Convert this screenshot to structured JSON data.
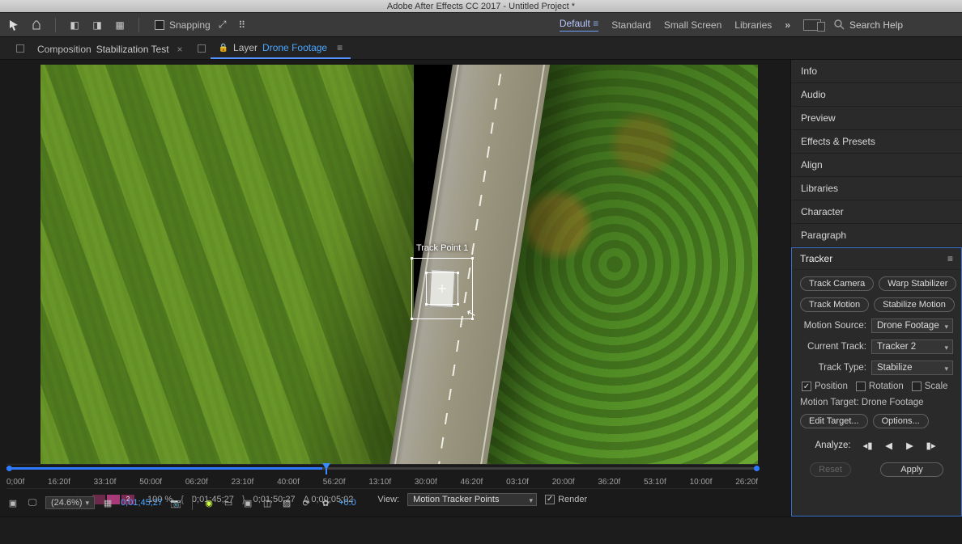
{
  "title": "Adobe After Effects CC 2017 - Untitled Project *",
  "toolbar": {
    "snapping_label": "Snapping",
    "workspaces": [
      "Default",
      "Standard",
      "Small Screen",
      "Libraries"
    ],
    "active_workspace_index": 0,
    "search_placeholder": "Search Help"
  },
  "tabs": {
    "tab1_prefix": "Composition",
    "tab1_name": "Stabilization Test",
    "tab2_prefix": "Layer",
    "tab2_name": "Drone Footage"
  },
  "track_point_label": "Track Point 1",
  "ruler_labels": [
    "0;00f",
    "16:20f",
    "33:10f",
    "50:00f",
    "06:20f",
    "23:10f",
    "40:00f",
    "56:20f",
    "13:10f",
    "30:00f",
    "46:20f",
    "03:10f",
    "20:00f",
    "36:20f",
    "53:10f",
    "10:00f",
    "26:20f"
  ],
  "footer": {
    "res_percent": "100 %",
    "tc1": "0;01;45;27",
    "tc2": "0;01;50;27",
    "tc_delta": "0;00;05;02",
    "view_label": "View:",
    "view_value": "Motion Tracker Points",
    "render_label": "Render"
  },
  "status": {
    "zoom": "(24.6%)",
    "timecode": "0;01;45;27",
    "exposure": "+0.0"
  },
  "panels": [
    "Info",
    "Audio",
    "Preview",
    "Effects & Presets",
    "Align",
    "Libraries",
    "Character",
    "Paragraph"
  ],
  "tracker": {
    "title": "Tracker",
    "track_camera": "Track Camera",
    "warp_stabilizer": "Warp Stabilizer",
    "track_motion": "Track Motion",
    "stabilize_motion": "Stabilize Motion",
    "motion_source_label": "Motion Source:",
    "motion_source_value": "Drone Footage",
    "current_track_label": "Current Track:",
    "current_track_value": "Tracker 2",
    "track_type_label": "Track Type:",
    "track_type_value": "Stabilize",
    "position_label": "Position",
    "rotation_label": "Rotation",
    "scale_label": "Scale",
    "motion_target_label": "Motion Target: Drone Footage",
    "edit_target": "Edit Target...",
    "options": "Options...",
    "analyze_label": "Analyze:",
    "reset": "Reset",
    "apply": "Apply"
  }
}
